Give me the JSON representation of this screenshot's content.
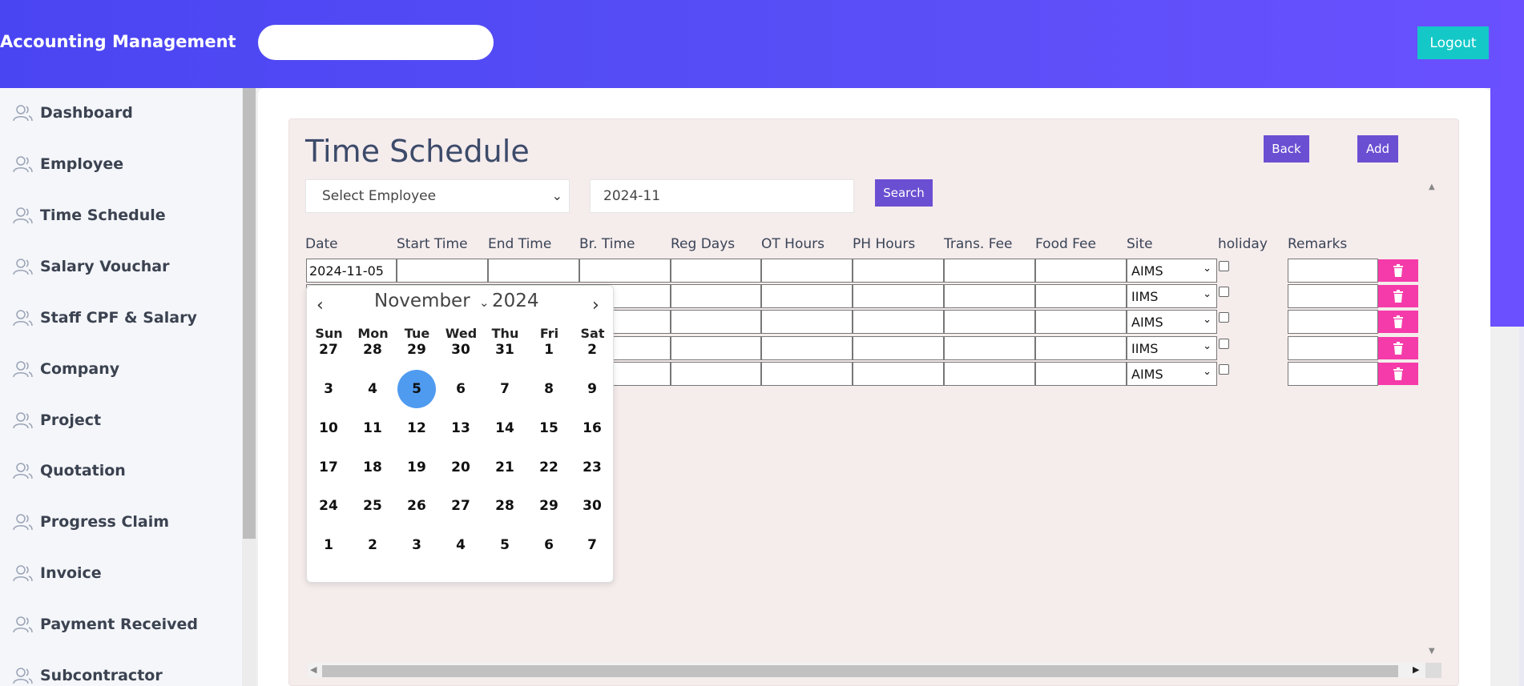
{
  "header": {
    "brand": "Accounting Management",
    "logout_label": "Logout"
  },
  "sidebar": {
    "items": [
      {
        "label": "Dashboard"
      },
      {
        "label": "Employee"
      },
      {
        "label": "Time Schedule"
      },
      {
        "label": "Salary Vouchar"
      },
      {
        "label": "Staff CPF & Salary"
      },
      {
        "label": "Company"
      },
      {
        "label": "Project"
      },
      {
        "label": "Quotation"
      },
      {
        "label": "Progress Claim"
      },
      {
        "label": "Invoice"
      },
      {
        "label": "Payment Received"
      },
      {
        "label": "Subcontractor"
      }
    ],
    "icon": "user-icon"
  },
  "page": {
    "title": "Time Schedule",
    "back_label": "Back",
    "add_label": "Add",
    "employee_select": "Select Employee",
    "month_value": "2024-11",
    "search_label": "Search"
  },
  "table": {
    "headers": [
      "Date",
      "Start Time",
      "End Time",
      "Br. Time",
      "Reg Days",
      "OT Hours",
      "PH Hours",
      "Trans. Fee",
      "Food Fee",
      "Site",
      "holiday",
      "Remarks"
    ],
    "rows": [
      {
        "date": "2024-11-05",
        "site": "AIMS"
      },
      {
        "date": "",
        "site": "IIMS"
      },
      {
        "date": "",
        "site": "AIMS"
      },
      {
        "date": "",
        "site": "IIMS"
      },
      {
        "date": "",
        "site": "AIMS"
      }
    ],
    "delete_icon": "trash-icon"
  },
  "datepicker": {
    "month": "November",
    "year": "2024",
    "weekdays": [
      "Sun",
      "Mon",
      "Tue",
      "Wed",
      "Thu",
      "Fri",
      "Sat"
    ],
    "weeks": [
      [
        "27",
        "28",
        "29",
        "30",
        "31",
        "1",
        "2"
      ],
      [
        "3",
        "4",
        "5",
        "6",
        "7",
        "8",
        "9"
      ],
      [
        "10",
        "11",
        "12",
        "13",
        "14",
        "15",
        "16"
      ],
      [
        "17",
        "18",
        "19",
        "20",
        "21",
        "22",
        "23"
      ],
      [
        "24",
        "25",
        "26",
        "27",
        "28",
        "29",
        "30"
      ],
      [
        "1",
        "2",
        "3",
        "4",
        "5",
        "6",
        "7"
      ]
    ],
    "selected_day": "5",
    "selected_color": "#4f9bf0"
  },
  "colors": {
    "header": "#5a4ff7",
    "logout": "#14c8c8",
    "button": "#6a4fd2",
    "delete": "#f53ba9"
  }
}
